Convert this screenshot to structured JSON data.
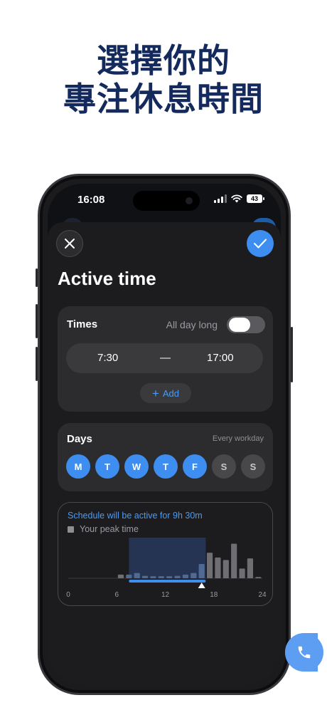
{
  "promo": {
    "line1": "選擇你的",
    "line2": "專注休息時間"
  },
  "status_bar": {
    "time": "16:08",
    "battery": "43"
  },
  "sheet": {
    "title": "Active time"
  },
  "times_card": {
    "label": "Times",
    "all_day_label": "All day long",
    "all_day_enabled": false,
    "start": "7:30",
    "separator": "—",
    "end": "17:00",
    "add_label": "Add"
  },
  "days_card": {
    "label": "Days",
    "preset": "Every workday",
    "days": [
      {
        "label": "M",
        "active": true
      },
      {
        "label": "T",
        "active": true
      },
      {
        "label": "W",
        "active": true
      },
      {
        "label": "T",
        "active": true
      },
      {
        "label": "F",
        "active": true
      },
      {
        "label": "S",
        "active": false
      },
      {
        "label": "S",
        "active": false
      }
    ]
  },
  "schedule": {
    "summary": "Schedule will be active for 9h 30m",
    "legend": "Your peak time"
  },
  "colors": {
    "accent": "#3d8ef0",
    "headline": "#142a5c",
    "sheet": "#1c1c1e",
    "card": "#2c2c2e"
  },
  "chart_data": {
    "type": "bar",
    "x_ticks": [
      "0",
      "6",
      "12",
      "18",
      "24"
    ],
    "xlim": [
      0,
      24
    ],
    "active_range": [
      7.5,
      17
    ],
    "marker": 16.5,
    "bars": [
      {
        "x": 6.5,
        "v": 0.09
      },
      {
        "x": 7.5,
        "v": 0.09
      },
      {
        "x": 8.5,
        "v": 0.13
      },
      {
        "x": 9.5,
        "v": 0.06
      },
      {
        "x": 10.5,
        "v": 0.05
      },
      {
        "x": 11.5,
        "v": 0.05
      },
      {
        "x": 12.5,
        "v": 0.05
      },
      {
        "x": 13.5,
        "v": 0.06
      },
      {
        "x": 14.5,
        "v": 0.09
      },
      {
        "x": 15.5,
        "v": 0.13
      },
      {
        "x": 16.5,
        "v": 0.35
      },
      {
        "x": 17.5,
        "v": 0.63
      },
      {
        "x": 18.5,
        "v": 0.51
      },
      {
        "x": 19.5,
        "v": 0.45
      },
      {
        "x": 20.5,
        "v": 0.85
      },
      {
        "x": 21.5,
        "v": 0.24
      },
      {
        "x": 22.5,
        "v": 0.49
      },
      {
        "x": 23.5,
        "v": 0.03
      }
    ]
  },
  "icons": {
    "close": "close-icon",
    "confirm": "checkmark-icon",
    "add": "plus-icon",
    "fab": "phone-icon"
  }
}
